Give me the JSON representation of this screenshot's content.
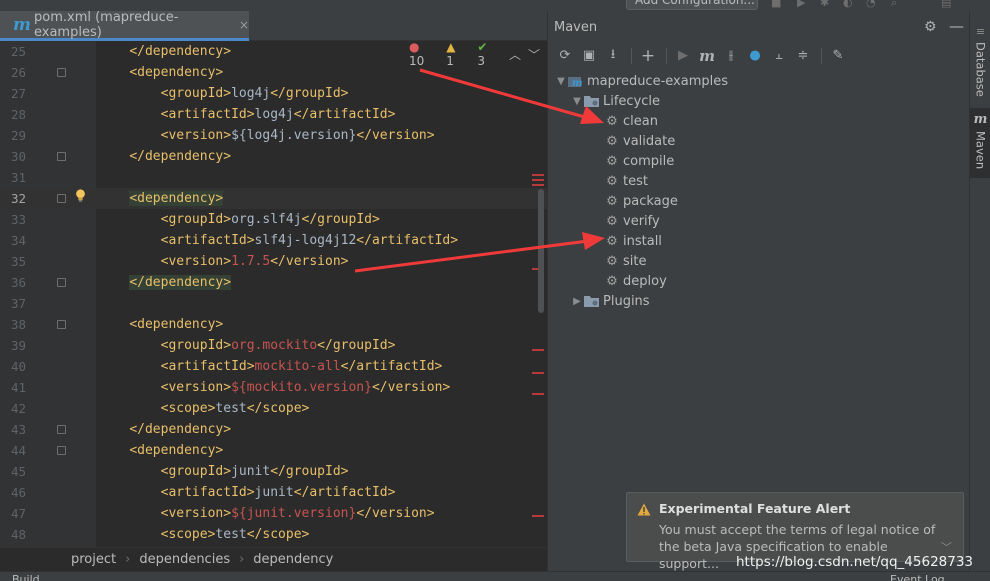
{
  "toolbar": {
    "run_config_label": "Add Configuration..."
  },
  "editor": {
    "tab": {
      "icon": "maven-m-icon",
      "label": "pom.xml (mapreduce-examples)",
      "close_glyph": "×"
    },
    "inspections": {
      "errors": "10",
      "warnings": "1",
      "weak_warnings": "3"
    },
    "current_line": 32,
    "lines": [
      {
        "n": "25",
        "indent": "    ",
        "parts": [
          [
            "tag",
            "</dependency>"
          ]
        ]
      },
      {
        "n": "26",
        "indent": "    ",
        "parts": [
          [
            "tag",
            "<dependency>"
          ]
        ]
      },
      {
        "n": "27",
        "indent": "        ",
        "parts": [
          [
            "tag",
            "<groupId>"
          ],
          [
            "txt",
            "log4j"
          ],
          [
            "tag",
            "</groupId>"
          ]
        ]
      },
      {
        "n": "28",
        "indent": "        ",
        "parts": [
          [
            "tag",
            "<artifactId>"
          ],
          [
            "txt",
            "log4j"
          ],
          [
            "tag",
            "</artifactId>"
          ]
        ]
      },
      {
        "n": "29",
        "indent": "        ",
        "parts": [
          [
            "tag",
            "<version>"
          ],
          [
            "txt",
            "${log4j.version}"
          ],
          [
            "tag",
            "</version>"
          ]
        ]
      },
      {
        "n": "30",
        "indent": "    ",
        "parts": [
          [
            "tag",
            "</dependency>"
          ]
        ]
      },
      {
        "n": "31",
        "indent": "",
        "parts": []
      },
      {
        "n": "32",
        "indent": "    ",
        "parts": [
          [
            "taghl",
            "<dependency>"
          ]
        ]
      },
      {
        "n": "33",
        "indent": "        ",
        "parts": [
          [
            "tag",
            "<groupId>"
          ],
          [
            "txt",
            "org.slf4j"
          ],
          [
            "tag",
            "</groupId>"
          ]
        ]
      },
      {
        "n": "34",
        "indent": "        ",
        "parts": [
          [
            "tag",
            "<artifactId>"
          ],
          [
            "txt",
            "slf4j-log4j12"
          ],
          [
            "tag",
            "</artifactId>"
          ]
        ]
      },
      {
        "n": "35",
        "indent": "        ",
        "parts": [
          [
            "tag",
            "<version>"
          ],
          [
            "red",
            "1.7.5"
          ],
          [
            "tag",
            "</version>"
          ]
        ]
      },
      {
        "n": "36",
        "indent": "    ",
        "parts": [
          [
            "taghl",
            "</dependency>"
          ]
        ]
      },
      {
        "n": "37",
        "indent": "",
        "parts": []
      },
      {
        "n": "38",
        "indent": "    ",
        "parts": [
          [
            "tag",
            "<dependency>"
          ]
        ]
      },
      {
        "n": "39",
        "indent": "        ",
        "parts": [
          [
            "tag",
            "<groupId>"
          ],
          [
            "red",
            "org.mockito"
          ],
          [
            "tag",
            "</groupId>"
          ]
        ]
      },
      {
        "n": "40",
        "indent": "        ",
        "parts": [
          [
            "tag",
            "<artifactId>"
          ],
          [
            "red",
            "mockito-all"
          ],
          [
            "tag",
            "</artifactId>"
          ]
        ]
      },
      {
        "n": "41",
        "indent": "        ",
        "parts": [
          [
            "tag",
            "<version>"
          ],
          [
            "red",
            "${mockito.version}"
          ],
          [
            "tag",
            "</version>"
          ]
        ]
      },
      {
        "n": "42",
        "indent": "        ",
        "parts": [
          [
            "tag",
            "<scope>"
          ],
          [
            "txt",
            "test"
          ],
          [
            "tag",
            "</scope>"
          ]
        ]
      },
      {
        "n": "43",
        "indent": "    ",
        "parts": [
          [
            "tag",
            "</dependency>"
          ]
        ]
      },
      {
        "n": "44",
        "indent": "    ",
        "parts": [
          [
            "tag",
            "<dependency>"
          ]
        ]
      },
      {
        "n": "45",
        "indent": "        ",
        "parts": [
          [
            "tag",
            "<groupId>"
          ],
          [
            "txt",
            "junit"
          ],
          [
            "tag",
            "</groupId>"
          ]
        ]
      },
      {
        "n": "46",
        "indent": "        ",
        "parts": [
          [
            "tag",
            "<artifactId>"
          ],
          [
            "txt",
            "junit"
          ],
          [
            "tag",
            "</artifactId>"
          ]
        ]
      },
      {
        "n": "47",
        "indent": "        ",
        "parts": [
          [
            "tag",
            "<version>"
          ],
          [
            "red",
            "${junit.version}"
          ],
          [
            "tag",
            "</version>"
          ]
        ]
      },
      {
        "n": "48",
        "indent": "        ",
        "parts": [
          [
            "tag",
            "<scope>"
          ],
          [
            "txt",
            "test"
          ],
          [
            "tag",
            "</scope>"
          ]
        ]
      }
    ],
    "breadcrumbs": [
      "project",
      "dependencies",
      "dependency"
    ]
  },
  "maven": {
    "title": "Maven",
    "project": "mapreduce-examples",
    "lifecycle_label": "Lifecycle",
    "goals": [
      "clean",
      "validate",
      "compile",
      "test",
      "package",
      "verify",
      "install",
      "site",
      "deploy"
    ],
    "plugins_label": "Plugins"
  },
  "tool_strip": {
    "database_label": "Database",
    "maven_label": "Maven"
  },
  "notification": {
    "title": "Experimental Feature Alert",
    "body": "You must accept the terms of legal notice of the beta Java specification to enable support..."
  },
  "status": {
    "left": "Build",
    "right": "Event Log"
  },
  "watermark": "https://blog.csdn.net/qq_45628733",
  "colors": {
    "annotation_arrow": "#f03a3a",
    "accent": "#4a88c7",
    "tag": "#e8bf6a",
    "error_text": "#c75450"
  }
}
